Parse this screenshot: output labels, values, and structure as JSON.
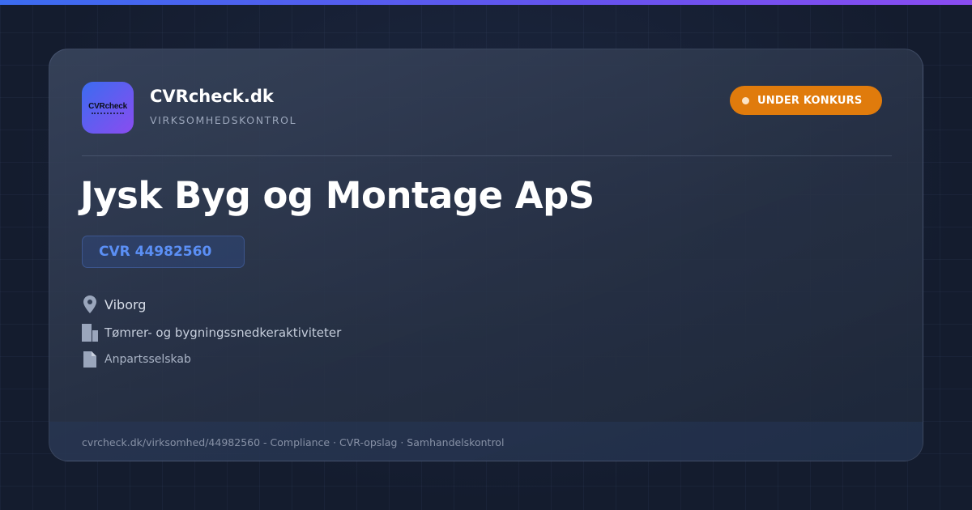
{
  "brand": {
    "logo_text": "CVRcheck",
    "name": "CVRcheck.dk",
    "tagline": "VIRKSOMHEDSKONTROL"
  },
  "status": {
    "label": "UNDER KONKURS",
    "color": "#e07b0c"
  },
  "company": {
    "name": "Jysk Byg og Montage ApS",
    "cvr": "CVR 44982560"
  },
  "details": {
    "city": "Viborg",
    "industry": "Tømrer- og bygningssnedkeraktiviteter",
    "company_type": "Anpartsselskab"
  },
  "icons": {
    "city": "location-pin-icon",
    "industry": "building-icon",
    "company_type": "document-icon"
  },
  "footer": {
    "text": "cvrcheck.dk/virksomhed/44982560 - Compliance · CVR-opslag · Samhandelskontrol"
  },
  "colors": {
    "accent_start": "#3b6cf0",
    "accent_end": "#8a4cf0",
    "cvr_text": "#5b8ff5",
    "background": "#141c2e"
  }
}
